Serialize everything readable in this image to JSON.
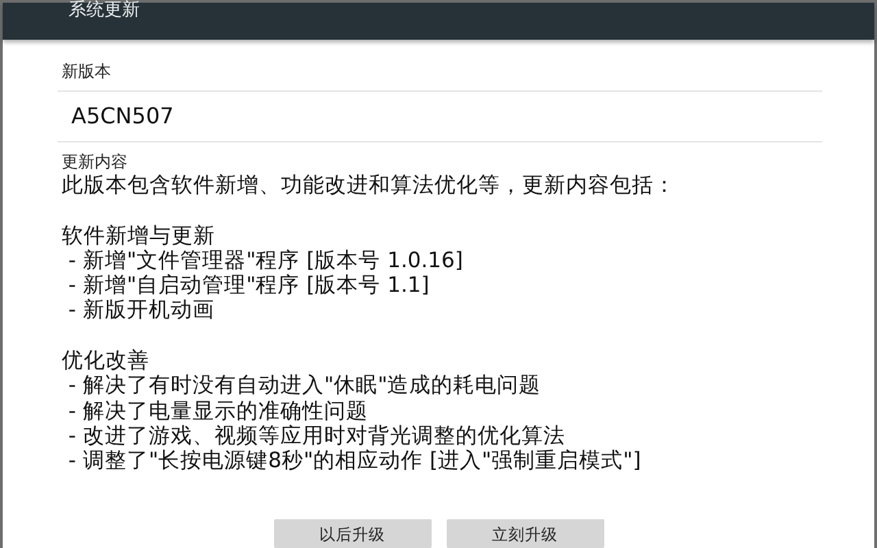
{
  "window": {
    "title": "系统更新"
  },
  "new_version": {
    "label": "新版本",
    "value": "A5CN507"
  },
  "changelog": {
    "label": "更新内容",
    "lines": [
      {
        "kind": "text",
        "text": "此版本包含软件新增、功能改进和算法优化等，更新内容包括："
      },
      {
        "kind": "blank"
      },
      {
        "kind": "heading",
        "text": "软件新增与更新"
      },
      {
        "kind": "item",
        "text": " - 新增\"文件管理器\"程序 [版本号 1.0.16]"
      },
      {
        "kind": "item",
        "text": " - 新增\"自启动管理\"程序 [版本号 1.1]"
      },
      {
        "kind": "item",
        "text": " - 新版开机动画"
      },
      {
        "kind": "blank"
      },
      {
        "kind": "heading",
        "text": "优化改善"
      },
      {
        "kind": "item",
        "text": " - 解决了有时没有自动进入\"休眠\"造成的耗电问题"
      },
      {
        "kind": "item",
        "text": " - 解决了电量显示的准确性问题"
      },
      {
        "kind": "item",
        "text": " - 改进了游戏、视频等应用时对背光调整的优化算法"
      },
      {
        "kind": "item",
        "text": " - 调整了\"长按电源键8秒\"的相应动作 [进入\"强制重启模式\"]"
      }
    ]
  },
  "buttons": [
    "以后升级",
    "立刻升级"
  ]
}
